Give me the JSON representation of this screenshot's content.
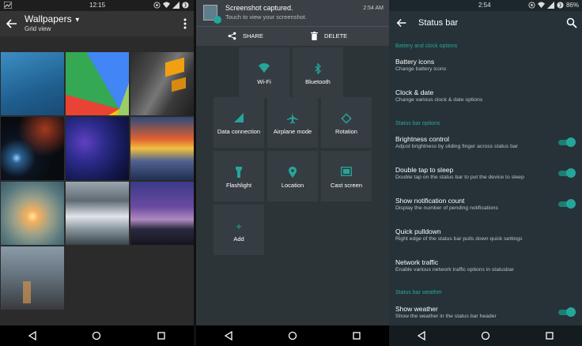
{
  "wallpapers": {
    "status_time": "12:15",
    "title": "Wallpapers",
    "subtitle": "Grid view",
    "tiles": [
      "wallpaper-blue",
      "wallpaper-kitkat",
      "wallpaper-building",
      "wallpaper-nebula",
      "wallpaper-stars",
      "wallpaper-rain",
      "wallpaper-sunset",
      "wallpaper-river",
      "wallpaper-mountain",
      "wallpaper-city"
    ]
  },
  "quick_settings": {
    "notification": {
      "title": "Screenshot captured.",
      "text": "Touch to view your screenshot.",
      "time": "2:54 AM",
      "share_label": "SHARE",
      "delete_label": "DELETE"
    },
    "tiles": [
      {
        "id": "wifi",
        "label": "Wi-Fi"
      },
      {
        "id": "bluetooth",
        "label": "Bluetooth"
      },
      {
        "id": "data",
        "label": "Data connection"
      },
      {
        "id": "airplane",
        "label": "Airplane mode"
      },
      {
        "id": "rotation",
        "label": "Rotation"
      },
      {
        "id": "flashlight",
        "label": "Flashlight"
      },
      {
        "id": "location",
        "label": "Location"
      },
      {
        "id": "cast",
        "label": "Cast screen"
      },
      {
        "id": "add",
        "label": "Add"
      }
    ]
  },
  "status_bar_settings": {
    "status_time": "2:54",
    "battery": "86%",
    "title": "Status bar",
    "sections": [
      "Battery and clock options",
      "Status bar options",
      "Status bar weather"
    ],
    "rows": [
      {
        "title": "Battery icons",
        "sub": "Change battery icons"
      },
      {
        "title": "Clock & date",
        "sub": "Change various clock & date options"
      },
      {
        "title": "Brightness control",
        "sub": "Adjust brightness by sliding finger across status bar",
        "toggle": true
      },
      {
        "title": "Double tap to sleep",
        "sub": "Double tap on the status bar to put the device to sleep",
        "toggle": true
      },
      {
        "title": "Show notification count",
        "sub": "Display the number of pending notifications",
        "toggle": true
      },
      {
        "title": "Quick pulldown",
        "sub": "Right edge of the status bar pulls down quick settings"
      },
      {
        "title": "Network traffic",
        "sub": "Enable various network traffic options in statusbar"
      },
      {
        "title": "Show weather",
        "sub": "Show the weather in the status bar header",
        "toggle": true
      }
    ]
  },
  "colors": {
    "accent": "#26a69a",
    "settings_bg": "#263238",
    "qs_bg": "#2d3438"
  }
}
